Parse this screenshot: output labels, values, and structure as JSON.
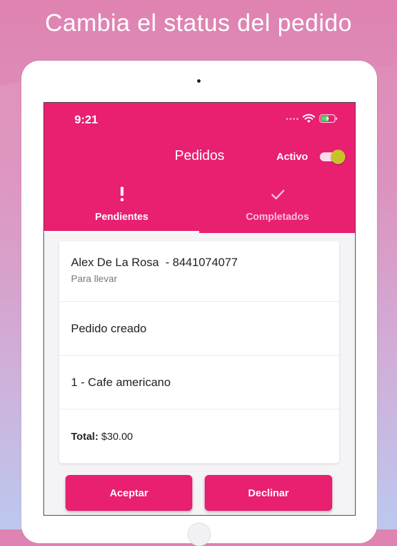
{
  "headline": "Cambia el status del pedido",
  "status_bar": {
    "time": "9:21",
    "icons": [
      "signal-dots-icon",
      "wifi-icon",
      "battery-charging-icon"
    ]
  },
  "app_bar": {
    "title": "Pedidos",
    "toggle_label": "Activo",
    "toggle_on": true
  },
  "tabs": [
    {
      "label": "Pendientes",
      "icon": "exclamation-icon",
      "selected": true
    },
    {
      "label": "Completados",
      "icon": "checkmark-icon",
      "selected": false
    }
  ],
  "order": {
    "customer": "Alex De La Rosa  - 8441074077",
    "type": "Para llevar",
    "status": "Pedido creado",
    "item": "1 - Cafe americano",
    "total_label": "Total:",
    "total_value": "$30.00"
  },
  "actions": {
    "accept": "Aceptar",
    "decline": "Declinar"
  },
  "colors": {
    "primary": "#e91f70",
    "toggle_knob": "#c9c02a",
    "battery": "#4cd964"
  }
}
